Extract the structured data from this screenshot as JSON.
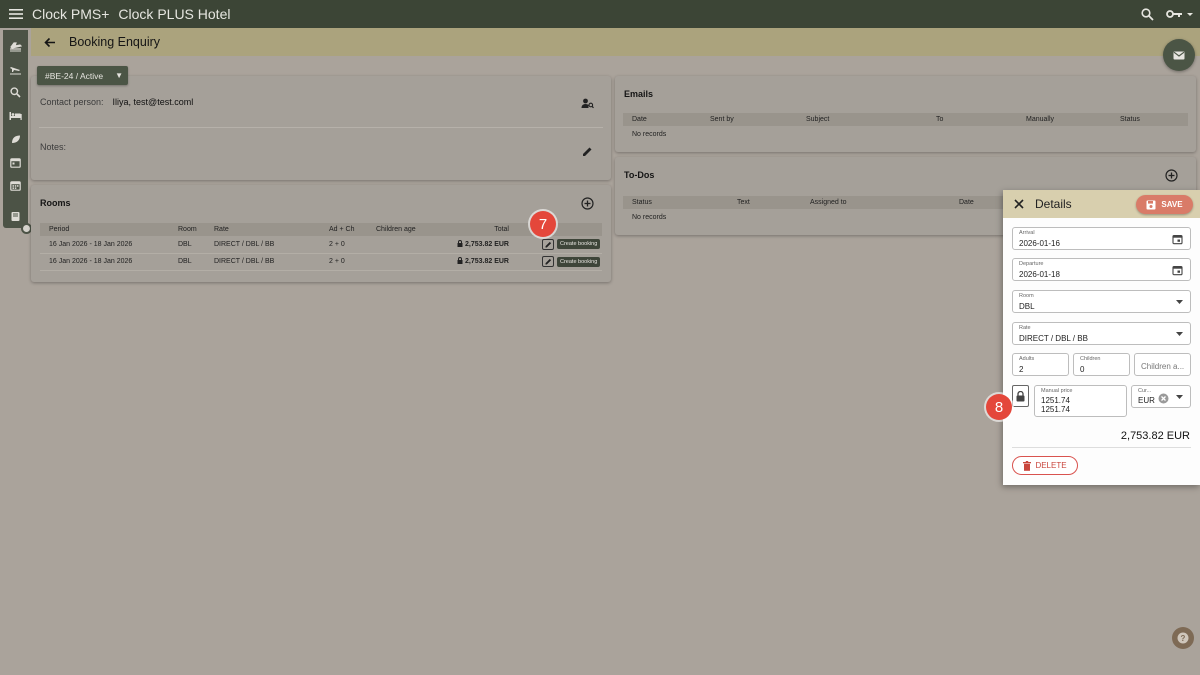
{
  "app": {
    "name": "Clock PMS+",
    "hotel": "Clock PLUS Hotel"
  },
  "header": {
    "title": "Booking Enquiry"
  },
  "status_button": {
    "label": "#BE-24 / Active"
  },
  "contact": {
    "label": "Contact person:",
    "value": "Iliya, test@test.coml",
    "notes_label": "Notes:"
  },
  "rooms": {
    "title": "Rooms",
    "columns": [
      "Period",
      "Room",
      "Rate",
      "Ad + Ch",
      "Children age",
      "Total"
    ],
    "rows": [
      {
        "period": "16 Jan 2026 - 18 Jan 2026",
        "room": "DBL",
        "rate": "DIRECT / DBL / BB",
        "guests": "2 + 0",
        "children_age": "",
        "total": "2,753.82 EUR",
        "action": "Create booking"
      },
      {
        "period": "16 Jan 2026 - 18 Jan 2026",
        "room": "DBL",
        "rate": "DIRECT / DBL / BB",
        "guests": "2 + 0",
        "children_age": "",
        "total": "2,753.82 EUR",
        "action": "Create booking"
      }
    ]
  },
  "emails": {
    "title": "Emails",
    "columns": [
      "Date",
      "Sent by",
      "Subject",
      "To",
      "Manually",
      "Status"
    ],
    "empty": "No records"
  },
  "todos": {
    "title": "To-Dos",
    "columns": [
      "Status",
      "Text",
      "Assigned to",
      "Date"
    ],
    "empty": "No records"
  },
  "details": {
    "title": "Details",
    "save_label": "SAVE",
    "arrival": {
      "label": "Arrival",
      "value": "2026-01-16"
    },
    "departure": {
      "label": "Departure",
      "value": "2026-01-18"
    },
    "room": {
      "label": "Room",
      "value": "DBL"
    },
    "rate": {
      "label": "Rate",
      "value": "DIRECT / DBL / BB"
    },
    "adults": {
      "label": "Adults",
      "value": "2"
    },
    "children": {
      "label": "Children",
      "value": "0"
    },
    "children_age": {
      "placeholder": "Children a..."
    },
    "manual_price": {
      "label": "Manual price",
      "value": "1251.74",
      "value2": "1251.74"
    },
    "currency": {
      "label": "Cur...",
      "value": "EUR"
    },
    "total": "2,753.82 EUR",
    "delete_label": "DELETE"
  },
  "steps": {
    "seven": "7",
    "eight": "8"
  },
  "colors": {
    "topbar": "#3c4536",
    "subheader": "#aba37d",
    "accent_red": "#e4473b",
    "save": "#d97b68"
  }
}
